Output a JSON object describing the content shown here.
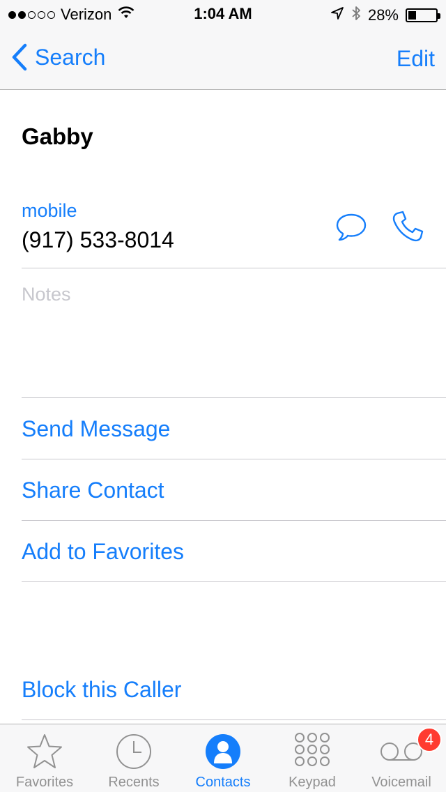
{
  "status_bar": {
    "carrier": "Verizon",
    "time": "1:04 AM",
    "battery_percent": "28%",
    "battery_level": 0.28,
    "signal_bars_filled": 2,
    "signal_bars_total": 5
  },
  "nav": {
    "back_label": "Search",
    "edit_label": "Edit"
  },
  "contact": {
    "name": "Gabby",
    "phone_label": "mobile",
    "phone_number": "(917) 533-8014",
    "notes_placeholder": "Notes"
  },
  "actions": {
    "send_message": "Send Message",
    "share_contact": "Share Contact",
    "add_to_favorites": "Add to Favorites",
    "block_caller": "Block this Caller"
  },
  "tabbar": {
    "tabs": [
      {
        "label": "Favorites",
        "icon": "star-icon"
      },
      {
        "label": "Recents",
        "icon": "clock-icon"
      },
      {
        "label": "Contacts",
        "icon": "contacts-icon",
        "active": true
      },
      {
        "label": "Keypad",
        "icon": "keypad-icon"
      },
      {
        "label": "Voicemail",
        "icon": "voicemail-icon"
      }
    ],
    "voicemail_badge": "4"
  },
  "colors": {
    "accent": "#157efb",
    "badge": "#ff3b30",
    "inactive_tab": "#929292",
    "placeholder": "#c7c7cd"
  }
}
